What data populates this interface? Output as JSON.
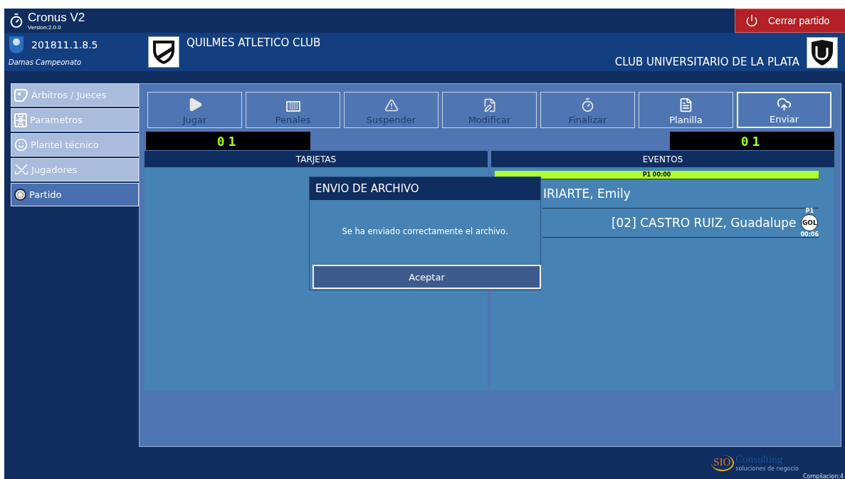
{
  "window": {
    "title": "Cronus V2",
    "version": "Version:2.0.0",
    "close_button": "Cerrar partido"
  },
  "match": {
    "code": "201811.1.8.5",
    "tournament": "Damas Campeonato",
    "home_team": "QUILMES ATLETICO CLUB",
    "away_team": "CLUB UNIVERSITARIO DE LA PLATA"
  },
  "sidebar": {
    "items": [
      {
        "label": "Árbitros / Jueces",
        "kind": "referee",
        "selected": false
      },
      {
        "label": "Parametros",
        "kind": "field",
        "selected": false
      },
      {
        "label": "Plantel técnico",
        "kind": "staff",
        "selected": false
      },
      {
        "label": "Jugadores",
        "kind": "players",
        "selected": false
      },
      {
        "label": "Partido",
        "kind": "match",
        "selected": true
      }
    ]
  },
  "toolbar": [
    {
      "label": "Jugar",
      "kind": "play",
      "disabled": true,
      "focused": false
    },
    {
      "label": "Penales",
      "kind": "penalties",
      "disabled": true,
      "focused": false
    },
    {
      "label": "Suspender",
      "kind": "suspend",
      "disabled": true,
      "focused": false
    },
    {
      "label": "Modificar",
      "kind": "edit",
      "disabled": true,
      "focused": false
    },
    {
      "label": "Finalizar",
      "kind": "finish",
      "disabled": true,
      "focused": false
    },
    {
      "label": "Planilla",
      "kind": "sheet",
      "disabled": false,
      "focused": false
    },
    {
      "label": "Enviar",
      "kind": "send",
      "disabled": false,
      "focused": true
    }
  ],
  "scores": {
    "home": "01",
    "away": "01"
  },
  "panels": {
    "cards_title": "TARJETAS",
    "events_title": "EVENTOS"
  },
  "events": [
    {
      "kind": "period",
      "label": "P1 00:00"
    },
    {
      "kind": "player",
      "label": "IRIARTE, Emily"
    },
    {
      "kind": "goal",
      "label": "[02] CASTRO RUIZ, Guadalupe",
      "period": "P1",
      "badge": "GOL",
      "time": "00:06"
    }
  ],
  "dialog": {
    "title": "ENVIO DE ARCHIVO",
    "message": "Se ha enviado correctamente el archivo.",
    "button": "Aceptar"
  },
  "footer": {
    "logo_mark": "SIO",
    "logo_name": "Consulting",
    "tagline": "soluciones de negocio",
    "build": "Compilacion:4"
  }
}
